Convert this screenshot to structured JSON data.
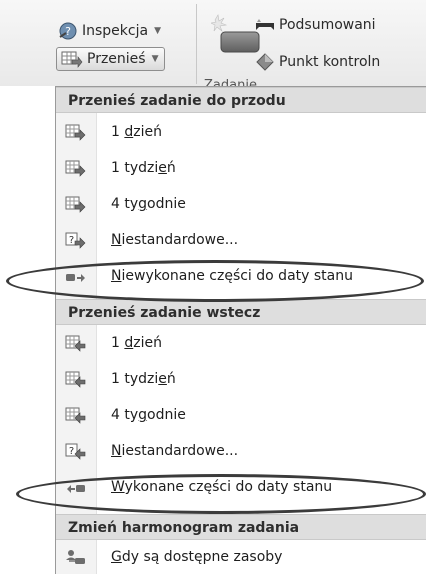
{
  "ribbon": {
    "inspekcja_label": "Inspekcja",
    "przenies_label": "Przenieś",
    "podsumowanie_label": "Podsumowani",
    "punkt_label": "Punkt kontroln",
    "zadanie_label": "Zadanie"
  },
  "menu": {
    "forward_header": "Przenieś zadanie do przodu",
    "forward": [
      {
        "pre": "1 ",
        "ul": "d",
        "post": "zień",
        "icon": "calendar-forward-icon"
      },
      {
        "pre": "1 tydzi",
        "ul": "e",
        "post": "ń",
        "icon": "calendar-forward-icon"
      },
      {
        "pre": "4 ty",
        "ul": "g",
        "post": "odnie",
        "icon": "calendar-forward-icon"
      },
      {
        "pre": "",
        "ul": "N",
        "post": "iestandardowe...",
        "icon": "custom-forward-icon"
      },
      {
        "pre": "",
        "ul": "N",
        "post": "iewykonane części do daty stanu",
        "icon": "incomplete-forward-icon"
      }
    ],
    "backward_header": "Przenieś zadanie wstecz",
    "backward": [
      {
        "pre": "1 ",
        "ul": "d",
        "post": "zień",
        "icon": "calendar-back-icon"
      },
      {
        "pre": "1 tydzi",
        "ul": "e",
        "post": "ń",
        "icon": "calendar-back-icon"
      },
      {
        "pre": "4 ty",
        "ul": "g",
        "post": "odnie",
        "icon": "calendar-back-icon"
      },
      {
        "pre": "",
        "ul": "N",
        "post": "iestandardowe...",
        "icon": "custom-back-icon"
      },
      {
        "pre": "",
        "ul": "W",
        "post": "ykonane części do daty stanu",
        "icon": "completed-back-icon"
      }
    ],
    "reschedule_header": "Zmień harmonogram zadania",
    "reschedule": [
      {
        "pre": "",
        "ul": "G",
        "post": "dy są dostępne zasoby",
        "icon": "resources-available-icon"
      }
    ]
  }
}
